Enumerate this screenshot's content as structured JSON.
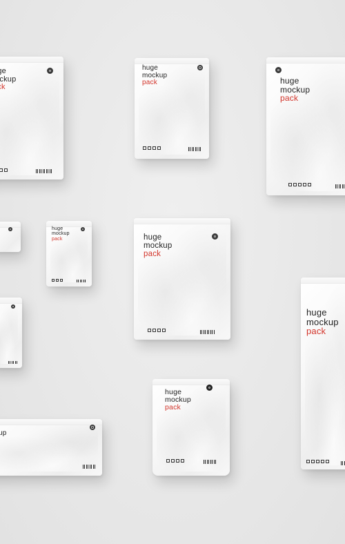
{
  "label": {
    "line1": "huge",
    "line2": "mockup",
    "line3": "pack",
    "partial_line1": "uge",
    "partial_line2": "ckup",
    "partial_line3": "ack",
    "partial_line_up": "up"
  },
  "colors": {
    "background": "#e9e9e9",
    "accent_red": "#d2342a",
    "text_dark": "#222222"
  }
}
